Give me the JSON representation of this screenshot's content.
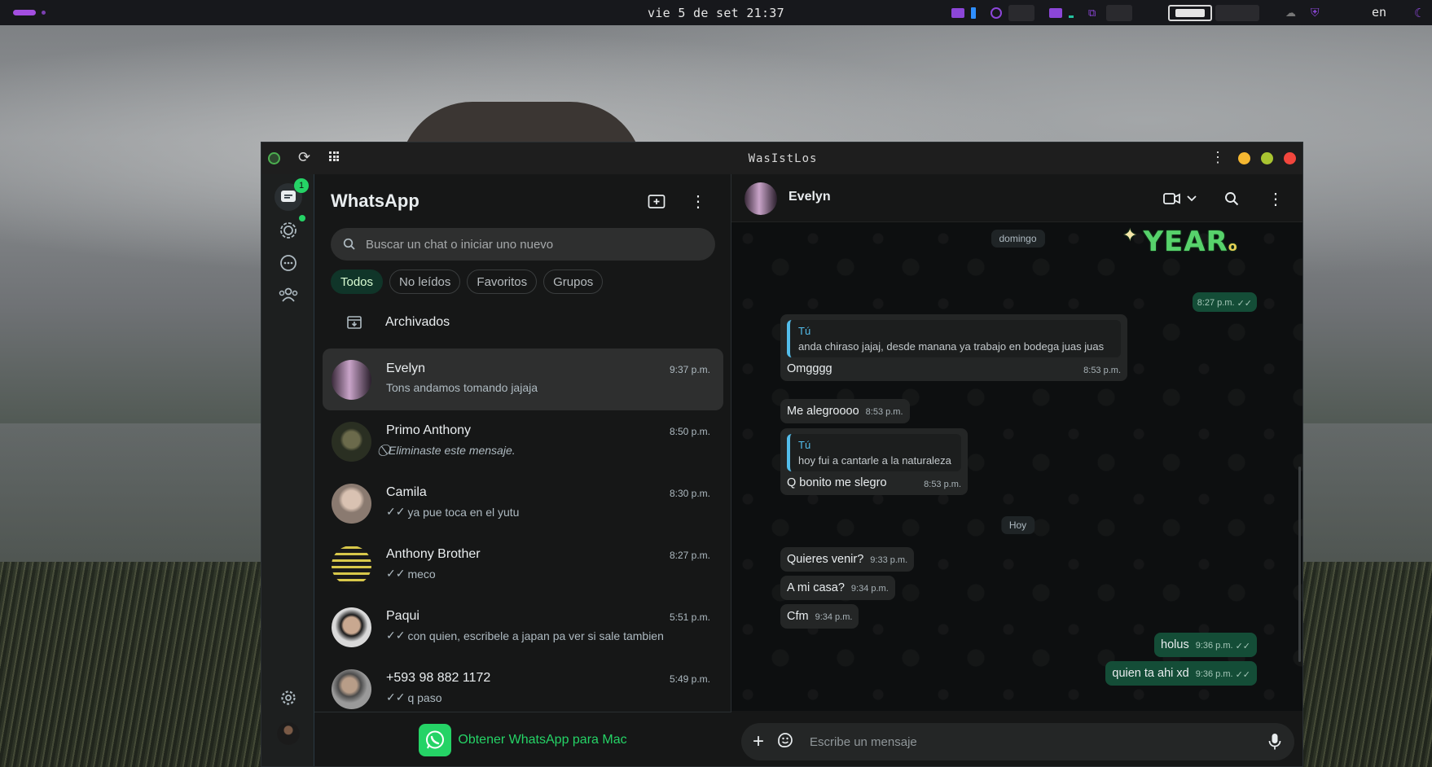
{
  "system_bar": {
    "clock": "vie 5 de set 21:37",
    "language": "en"
  },
  "window": {
    "title": "WasIstLos"
  },
  "rail": {
    "chats_badge": "1"
  },
  "sidebar": {
    "title": "WhatsApp",
    "search_placeholder": "Buscar un chat o iniciar uno nuevo",
    "filters": [
      "Todos",
      "No leídos",
      "Favoritos",
      "Grupos"
    ],
    "archived_label": "Archivados",
    "chats": [
      {
        "name": "Evelyn",
        "time": "9:37 p.m.",
        "message": "Tons andamos tomando jajaja",
        "ticks": false,
        "deleted": false,
        "selected": true
      },
      {
        "name": "Primo Anthony",
        "time": "8:50 p.m.",
        "message": "Eliminaste este mensaje.",
        "ticks": false,
        "deleted": true,
        "selected": false
      },
      {
        "name": "Camila",
        "time": "8:30 p.m.",
        "message": "ya pue toca en el yutu",
        "ticks": true,
        "deleted": false,
        "selected": false
      },
      {
        "name": "Anthony Brother",
        "time": "8:27 p.m.",
        "message": "meco",
        "ticks": true,
        "deleted": false,
        "selected": false
      },
      {
        "name": "Paqui",
        "time": "5:51 p.m.",
        "message": "con quien, escribele a japan pa ver si sale tambien",
        "ticks": true,
        "deleted": false,
        "selected": false
      },
      {
        "name": "+593 98 882 1172",
        "time": "5:49 p.m.",
        "message": "q paso",
        "ticks": true,
        "deleted": false,
        "selected": false
      }
    ],
    "mac_promo": "Obtener WhatsApp para Mac"
  },
  "conversation": {
    "contact_name": "Evelyn",
    "sticker_text": "YEAR",
    "dates": {
      "first": "domingo",
      "second": "Hoy"
    },
    "messages": [
      {
        "dir": "out",
        "text": "",
        "time": "8:27 p.m."
      },
      {
        "dir": "in",
        "quote_who": "Tú",
        "quote_text": "anda chiraso jajaj, desde manana ya trabajo en bodega juas juas",
        "text": "Omgggg",
        "time": "8:53 p.m."
      },
      {
        "dir": "in",
        "text": "Me alegroooo",
        "time": "8:53 p.m."
      },
      {
        "dir": "in",
        "quote_who": "Tú",
        "quote_text": "hoy fui a cantarle a la naturaleza",
        "text": "Q bonito me slegro",
        "time": "8:53 p.m."
      },
      {
        "dir": "in",
        "text": "Quieres venir?",
        "time": "9:33 p.m."
      },
      {
        "dir": "in",
        "text": "A mi casa?",
        "time": "9:34 p.m."
      },
      {
        "dir": "in",
        "text": "Cfm",
        "time": "9:34 p.m."
      },
      {
        "dir": "out",
        "text": "holus",
        "time": "9:36 p.m."
      },
      {
        "dir": "out",
        "text": "quien ta ahi xd",
        "time": "9:36 p.m."
      }
    ],
    "composer_placeholder": "Escribe un mensaje"
  },
  "colors": {
    "accent": "#25d366",
    "outgoing_bubble": "#144d37",
    "incoming_bubble": "#242626",
    "quote_bar": "#53bdeb"
  }
}
